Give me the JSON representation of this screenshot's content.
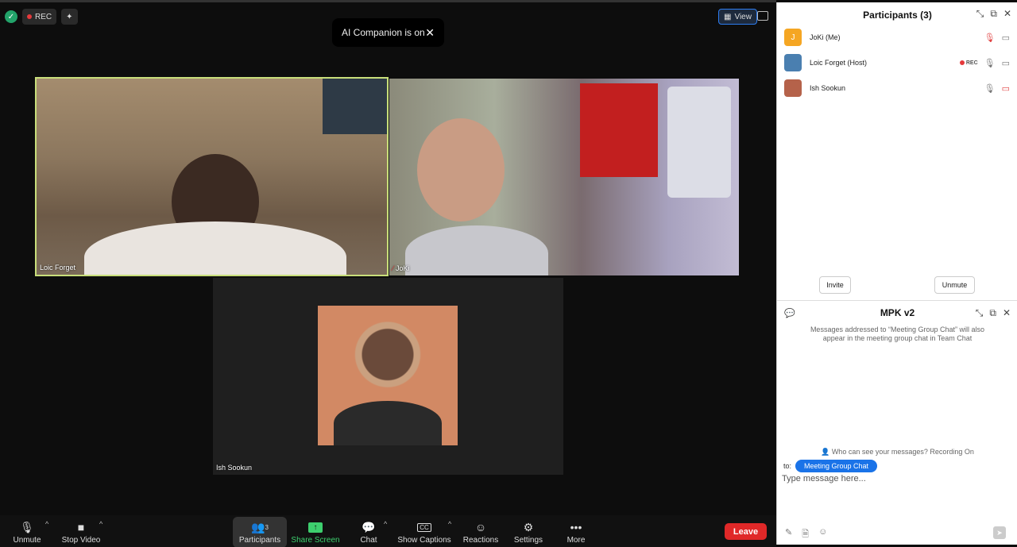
{
  "meeting": {
    "rec_label": "REC",
    "view_label": "View",
    "toast": {
      "text": "AI Companion is on",
      "close": "✕"
    },
    "tiles": [
      {
        "name": "Loic Forget"
      },
      {
        "name": "JoKi"
      },
      {
        "name": "Ish Sookun"
      }
    ]
  },
  "toolbar": {
    "unmute": "Unmute",
    "stop_video": "Stop Video",
    "participants": "Participants",
    "participants_count": "3",
    "share_screen": "Share Screen",
    "chat": "Chat",
    "show_captions": "Show Captions",
    "captions_icon": "CC",
    "reactions": "Reactions",
    "settings": "Settings",
    "more": "More",
    "leave": "Leave"
  },
  "participants_panel": {
    "title": "Participants (3)",
    "list": [
      {
        "name": "JoKi (Me)",
        "initial": "J",
        "avatar_color": "#f5a623",
        "rec": ""
      },
      {
        "name": "Loic Forget (Host)",
        "initial": "",
        "avatar_color": "#4a7fb0",
        "rec": "REC"
      },
      {
        "name": "Ish Sookun",
        "initial": "",
        "avatar_color": "#b5624a",
        "rec": ""
      }
    ],
    "invite_button": "Invite",
    "unmute_button": "Unmute"
  },
  "chat_panel": {
    "title": "MPK v2",
    "notice": "Messages addressed to “Meeting Group Chat” will also appear in the meeting group chat in Team Chat",
    "who_can_see": "Who can see your messages? Recording On",
    "to_label": "to:",
    "to_target": "Meeting Group Chat",
    "input_placeholder": "Type message here..."
  },
  "colors": {
    "active_speaker_border": "#c8de7a",
    "leave_red": "#e02828",
    "accent_blue": "#1a73e8",
    "share_green": "#3dcf6e"
  }
}
